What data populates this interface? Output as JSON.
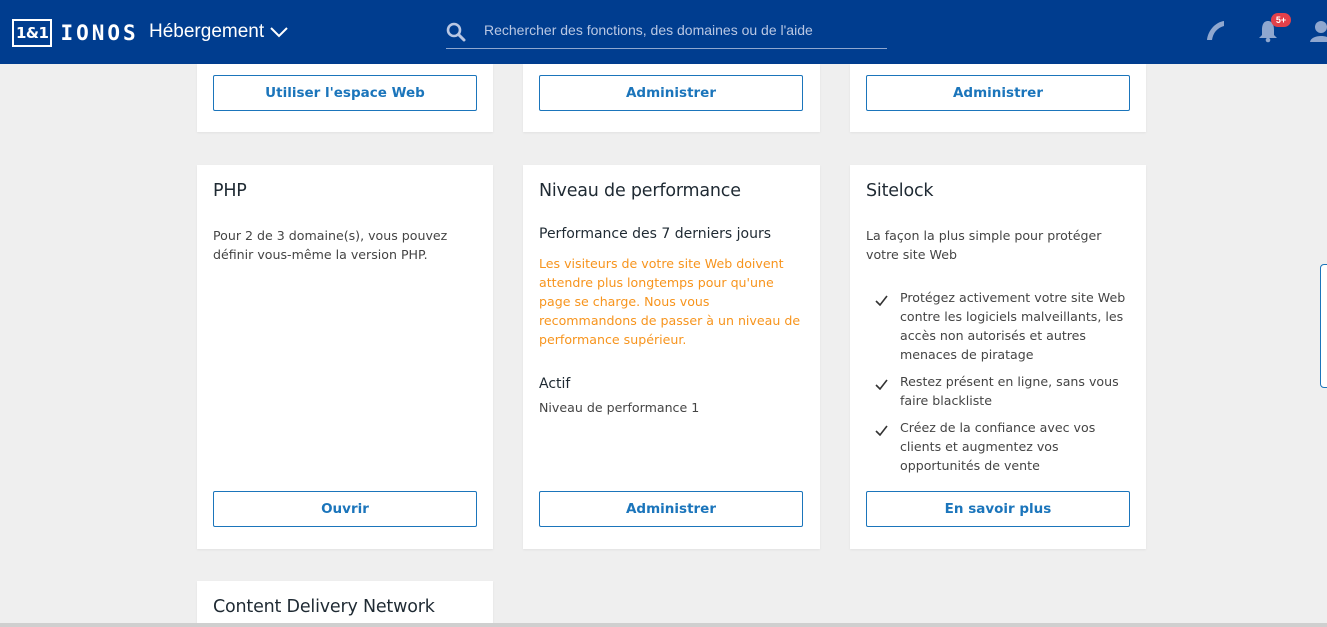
{
  "header": {
    "logo_box": "1&1",
    "logo_word": "IONOS",
    "section_title": "Hébergement",
    "search_placeholder": "Rechercher des fonctions, des domaines ou de l'aide",
    "notifications_badge": "5+",
    "brand_color": "#003d8f"
  },
  "top_row": {
    "col1_button": "Utiliser l'espace Web",
    "col2_button": "Administrer",
    "col3_button": "Administrer"
  },
  "php_card": {
    "title": "PHP",
    "description": "Pour 2 de 3 domaine(s), vous pouvez définir vous-même la version PHP.",
    "button": "Ouvrir"
  },
  "performance_card": {
    "title": "Niveau de performance",
    "subtitle": "Performance des 7 derniers jours",
    "warning": "Les visiteurs de votre site Web doivent attendre plus longtemps pour qu'une page se charge. Nous vous recommandons de passer à un niveau de performance supérieur.",
    "status_label": "Actif",
    "status_value": "Niveau de performance 1",
    "button": "Administrer",
    "warning_color": "#f7941d"
  },
  "sitelock_card": {
    "title": "Sitelock",
    "description": "La façon la plus simple pour protéger votre site Web",
    "benefits": [
      "Protégez activement votre site Web contre les logiciels malveillants, les accès non autorisés et autres menaces de piratage",
      "Restez présent en ligne, sans vous faire blackliste",
      "Créez de la confiance avec vos clients et augmentez vos opportunités de vente"
    ],
    "button": "En savoir plus"
  },
  "cdn_card": {
    "title": "Content Delivery Network"
  },
  "accent_color": "#1b75bb"
}
